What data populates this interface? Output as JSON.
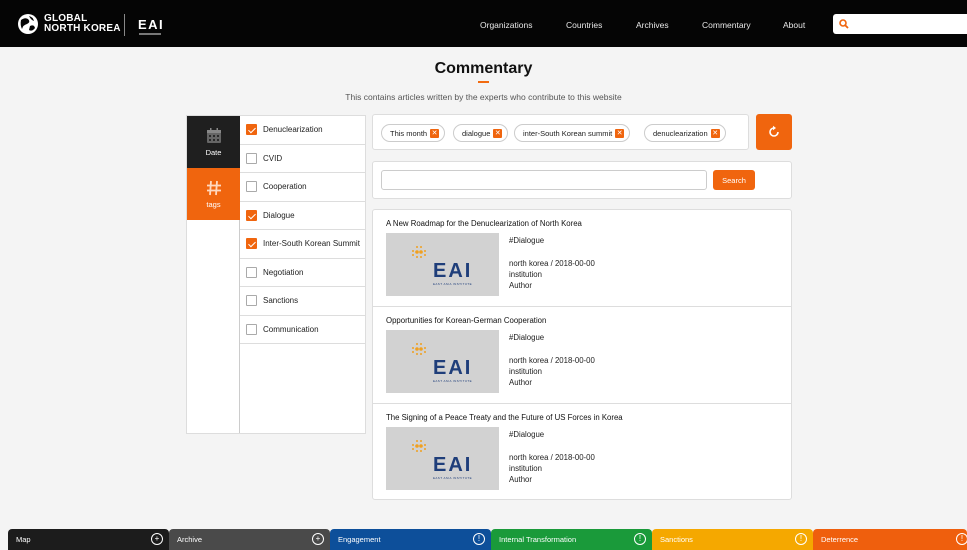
{
  "nav": {
    "logo_line1": "GLOBAL",
    "logo_line2": "NORTH KOREA",
    "eai_logo": "EAI",
    "links": [
      "Organizations",
      "Countries",
      "Archives",
      "Commentary",
      "About"
    ],
    "search_placeholder": ""
  },
  "page": {
    "title": "Commentary",
    "subtitle": "This contains articles written by the experts who contribute to this website"
  },
  "filters": {
    "tabs": [
      {
        "label": "Date",
        "icon": "calendar-icon"
      },
      {
        "label": "tags",
        "icon": "hashtag-icon"
      }
    ],
    "tags": [
      {
        "label": "Denuclearization",
        "checked": true
      },
      {
        "label": "CVID",
        "checked": false
      },
      {
        "label": "Cooperation",
        "checked": false
      },
      {
        "label": "Dialogue",
        "checked": true
      },
      {
        "label": "Inter-South Korean Summit",
        "checked": true
      },
      {
        "label": "Negotiation",
        "checked": false
      },
      {
        "label": "Sanctions",
        "checked": false
      },
      {
        "label": "Communication",
        "checked": false
      }
    ]
  },
  "chips": [
    "This month",
    "dialogue",
    "inter-South Korean summit",
    "denuclearization"
  ],
  "search": {
    "placeholder": "",
    "button": "Search"
  },
  "articles": [
    {
      "title": "A New Roadmap for the Denuclearization of North Korea",
      "tag": "#Dialogue",
      "meta": "north korea / 2018-00-00",
      "institution": "institution",
      "author": "Author",
      "thumb_logo": "EAI",
      "thumb_sub": "EAST ASIA INSTITUTE"
    },
    {
      "title": "Opportunities for Korean-German Cooperation",
      "tag": "#Dialogue",
      "meta": "north korea / 2018-00-00",
      "institution": "institution",
      "author": "Author",
      "thumb_logo": "EAI",
      "thumb_sub": "EAST ASIA INSTITUTE"
    },
    {
      "title": "The Signing of a Peace Treaty and the Future of US Forces in Korea",
      "tag": "#Dialogue",
      "meta": "north korea / 2018-00-00",
      "institution": "institution",
      "author": "Author",
      "thumb_logo": "EAI",
      "thumb_sub": "EAST ASIA INSTITUTE"
    }
  ],
  "bottom_tabs": [
    {
      "label": "Map",
      "color": "#1c1c1c",
      "icon": "plus-circle-icon",
      "glyph": "+"
    },
    {
      "label": "Archive",
      "color": "#4a4a4a",
      "icon": "plus-circle-icon",
      "glyph": "+"
    },
    {
      "label": "Engagement",
      "color": "#0d4f9a",
      "icon": "exclamation-circle-icon",
      "glyph": "!"
    },
    {
      "label": "Internal Transformation",
      "color": "#1a9a3a",
      "icon": "exclamation-circle-icon",
      "glyph": "!"
    },
    {
      "label": "Sanctions",
      "color": "#f5a800",
      "icon": "exclamation-circle-icon",
      "glyph": "!"
    },
    {
      "label": "Deterrence",
      "color": "#ef5f0d",
      "icon": "exclamation-circle-icon",
      "glyph": "!"
    }
  ],
  "colors": {
    "accent": "#f0650e",
    "nav_bg": "#050505",
    "eai_blue": "#1f3e7a"
  }
}
